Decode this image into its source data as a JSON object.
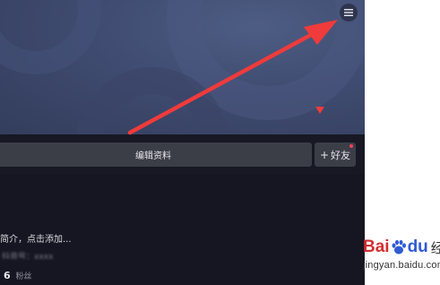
{
  "profile": {
    "edit_profile_label": "编辑资料",
    "add_friend_plus": "+",
    "add_friend_label": "好友",
    "bio_prompt": "简介，点击添加...",
    "blurred_info": "抖音号：xxxxxxx",
    "follow_count": "6",
    "follow_label": "粉丝"
  },
  "icons": {
    "menu": "hamburger-menu-icon",
    "banner_indicator": "red-triangle-icon",
    "annotation_arrow": "red-arrow-icon"
  },
  "watermark": {
    "logo_bai": "Bai",
    "logo_du": "du",
    "logo_suffix": "经验",
    "url": "jingyan.baidu.com"
  },
  "colors": {
    "banner": "#3f4b70",
    "background": "#161622",
    "button": "#3b3d47",
    "annotation": "#ef3b3b",
    "notify_dot": "#f1405b"
  }
}
